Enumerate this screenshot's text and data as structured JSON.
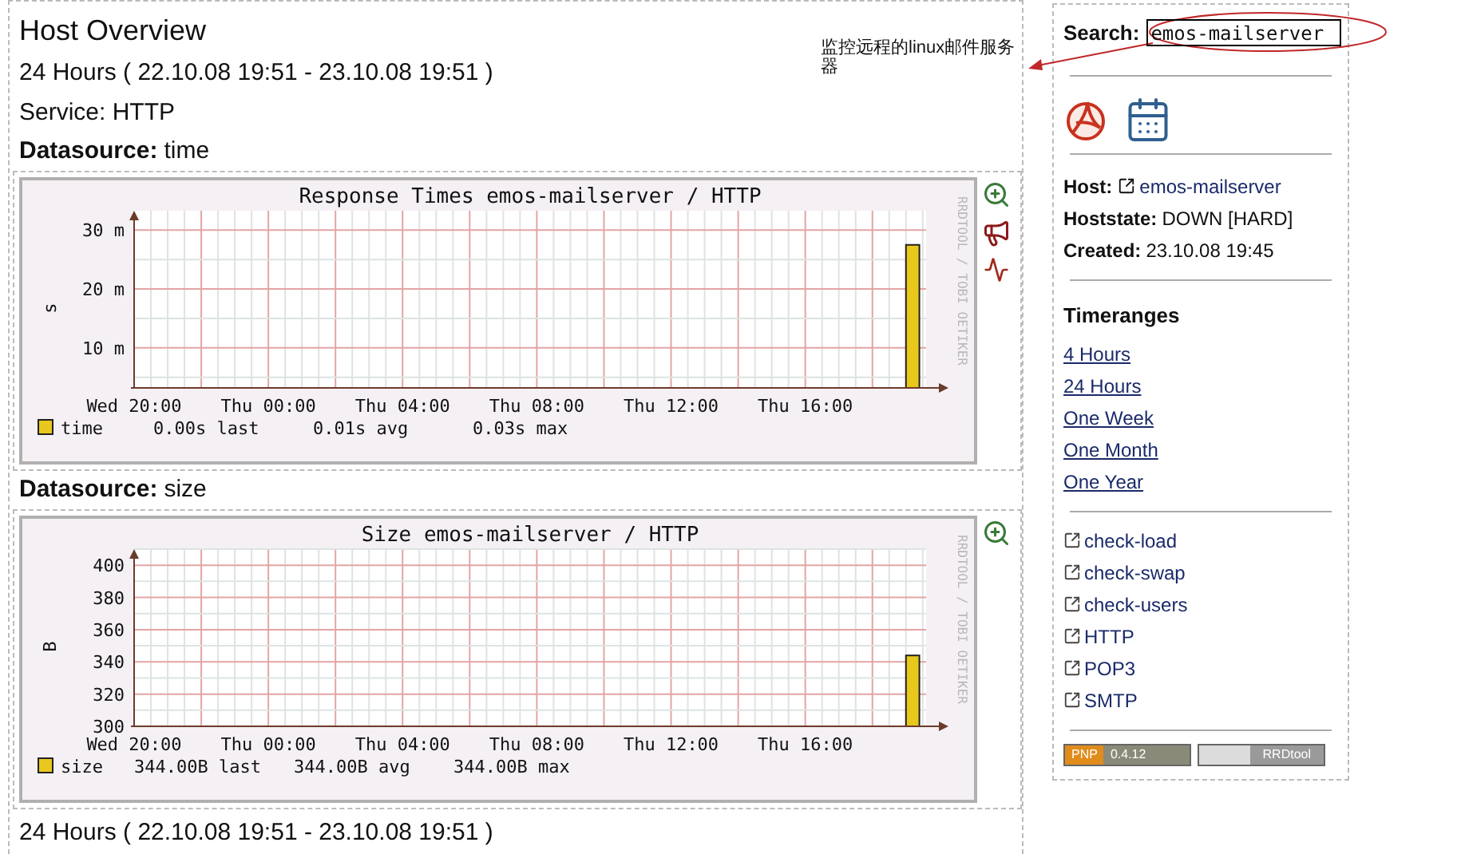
{
  "header": {
    "title": "Host Overview",
    "timerange": "24 Hours ( 22.10.08 19:51 - 23.10.08 19:51 )",
    "service": "Service: HTTP"
  },
  "annotation": {
    "text": "监控远程的linux邮件服务器"
  },
  "datasources": [
    {
      "label": "Datasource:",
      "name": "time",
      "credit": "RRDTOOL / TOBI OETIKER",
      "tools": [
        {
          "kind": "zoom"
        },
        {
          "kind": "alert"
        },
        {
          "kind": "wave"
        }
      ],
      "stats": [
        "0.00s last",
        "0.01s avg",
        "0.03s max"
      ],
      "chart_data": {
        "type": "bar",
        "grid": true,
        "title": "Response Times emos-mailserver / HTTP",
        "ylabel": "s",
        "categories": [
          "Wed 20:00",
          null,
          null,
          null,
          "Thu 00:00",
          null,
          null,
          null,
          "Thu 04:00",
          null,
          null,
          null,
          "Thu 08:00",
          null,
          null,
          null,
          "Thu 12:00",
          null,
          null,
          null,
          "Thu 16:00",
          null,
          null,
          null
        ],
        "series": [
          {
            "name": "time",
            "color": "#e8c81c",
            "values": [
              null,
              null,
              null,
              null,
              null,
              null,
              null,
              null,
              null,
              null,
              null,
              null,
              null,
              null,
              null,
              null,
              null,
              null,
              null,
              null,
              null,
              null,
              null,
              27.5
            ]
          }
        ],
        "ylim": [
          3.2,
          33.3
        ],
        "yticks": [
          {
            "value": 10,
            "label": "10 m"
          },
          {
            "value": 20,
            "label": "20 m"
          },
          {
            "value": 30,
            "label": "30 m"
          }
        ]
      }
    },
    {
      "label": "Datasource:",
      "name": "size",
      "credit": "RRDTOOL / TOBI OETIKER",
      "tools": [
        {
          "kind": "zoom"
        }
      ],
      "stats": [
        "344.00B last",
        "344.00B avg",
        "344.00B max"
      ],
      "chart_data": {
        "type": "bar",
        "grid": true,
        "title": "Size emos-mailserver / HTTP",
        "ylabel": "B",
        "categories": [
          "Wed 20:00",
          null,
          null,
          null,
          "Thu 00:00",
          null,
          null,
          null,
          "Thu 04:00",
          null,
          null,
          null,
          "Thu 08:00",
          null,
          null,
          null,
          "Thu 12:00",
          null,
          null,
          null,
          "Thu 16:00",
          null,
          null,
          null
        ],
        "series": [
          {
            "name": "size",
            "color": "#e8c81c",
            "values": [
              null,
              null,
              null,
              null,
              null,
              null,
              null,
              null,
              null,
              null,
              null,
              null,
              null,
              null,
              null,
              null,
              null,
              null,
              null,
              null,
              null,
              null,
              null,
              344
            ]
          }
        ],
        "ylim": [
          300,
          410
        ],
        "yticks": [
          300,
          320,
          340,
          360,
          380,
          400
        ]
      }
    }
  ],
  "footer": {
    "timerange": "24 Hours ( 22.10.08 19:51 - 23.10.08 19:51 )"
  },
  "sidebar": {
    "search": {
      "label": "Search:",
      "value": "emos-mailserver"
    },
    "actions": [
      {
        "kind": "pdf"
      },
      {
        "kind": "calendar"
      }
    ],
    "info": [
      {
        "label": "Host:",
        "value": "emos-mailserver",
        "link": true
      },
      {
        "label": "Hoststate:",
        "value": "DOWN [HARD]",
        "link": false
      },
      {
        "label": "Created:",
        "value": "23.10.08 19:45",
        "link": false
      }
    ],
    "timeranges": {
      "title": "Timeranges",
      "items": [
        "4 Hours",
        "24 Hours",
        "One Week",
        "One Month",
        "One Year"
      ]
    },
    "services": [
      "check-load",
      "check-swap",
      "check-users",
      "HTTP",
      "POP3",
      "SMTP"
    ],
    "badges": [
      {
        "kind": "pnp",
        "parts": [
          "PNP",
          "0.4.12"
        ]
      },
      {
        "kind": "rrdtool",
        "parts": [
          "RRDtool"
        ]
      }
    ]
  }
}
